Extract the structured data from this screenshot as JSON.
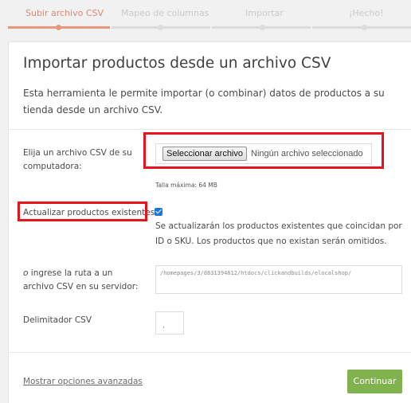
{
  "steps": [
    {
      "label": "Subir archivo CSV",
      "state": "active"
    },
    {
      "label": "Mapeo de columnas",
      "state": "pending"
    },
    {
      "label": "Importar",
      "state": "pending"
    },
    {
      "label": "¡Hecho!",
      "state": "pending"
    }
  ],
  "page": {
    "title": "Importar productos desde un archivo CSV",
    "intro": "Esta herramienta le permite importar (o combinar) datos de productos a su tienda desde un archivo CSV."
  },
  "file": {
    "label": "Elija un archivo CSV de su computadora:",
    "button": "Seleccionar archivo",
    "no_file": "Ningún archivo seleccionado",
    "max_size": "Talla máxima: 64 MB"
  },
  "update_existing": {
    "label": "Actualizar productos existentes",
    "checked": true,
    "description": "Se actualizarán los productos existentes que coincidan por ID o SKU. Los productos que no existan serán omitidos."
  },
  "server_path": {
    "label_prefix": "o",
    "label_rest": " ingrese la ruta a un archivo CSV en su servidor:",
    "value": "/homepages/3/d831394612/htdocs/clickandbuilds/elocalshop/"
  },
  "delimiter": {
    "label": "Delimitador CSV",
    "value": ","
  },
  "footer": {
    "advanced_link": "Mostrar opciones avanzadas",
    "continue": "Continuar"
  },
  "colors": {
    "accent": "#e8967c",
    "primary_button": "#80b34d",
    "highlight": "#e8131b",
    "checkbox": "#1877e0"
  }
}
